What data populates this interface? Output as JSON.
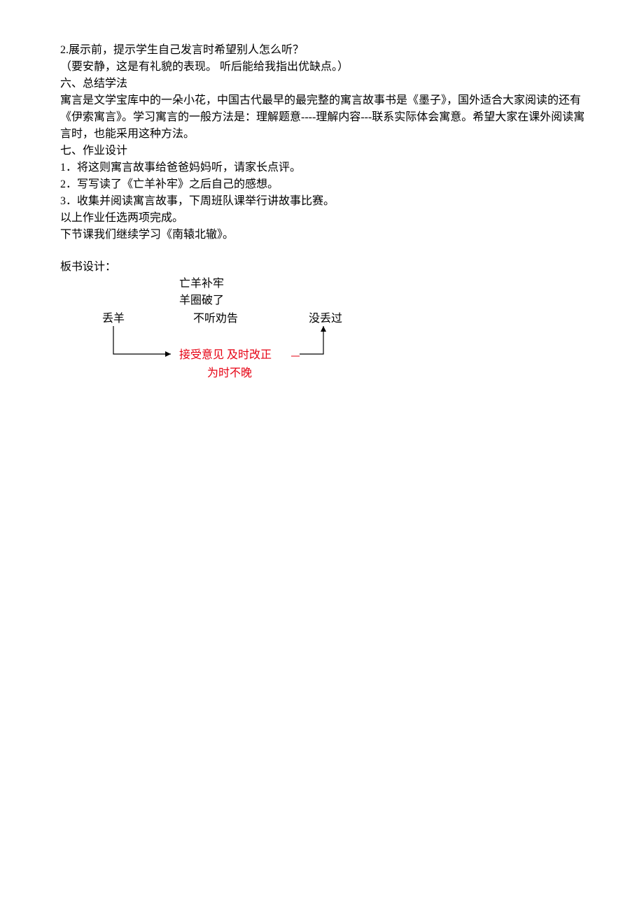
{
  "lines": {
    "l1": "2.展示前，提示学生自己发言时希望别人怎么听？",
    "l2": "（要安静，这是有礼貌的表现。 听后能给我指出优缺点。）",
    "l3": "六、总结学法",
    "l4": "寓言是文学宝库中的一朵小花，中国古代最早的最完整的寓言故事书是《墨子》，国外适合大家阅读的还有《伊索寓言》。学习寓言的一般方法是：理解题意----理解内容---联系实际体会寓意。希望大家在课外阅读寓言时，也能采用这种方法。",
    "l5": "七、作业设计",
    "l6": "1．将这则寓言故事给爸爸妈妈听，请家长点评。",
    "l7": "2．写写读了《亡羊补牢》之后自己的感想。",
    "l8": "3．收集并阅读寓言故事，下周班队课举行讲故事比赛。",
    "l9": "以上作业任选两项完成。",
    "l10": "下节课我们继续学习《南辕北辙》。",
    "l11": "板书设计："
  },
  "board": {
    "title": "亡羊补牢",
    "sub1": "羊圈破了",
    "left": "丢羊",
    "mid": "不听劝告",
    "right": "没丢过",
    "advice": "接受意见  及时改正",
    "conclusion": "为时不晚"
  },
  "watermark": "                                        \n                                        \n                                        \n                                        "
}
